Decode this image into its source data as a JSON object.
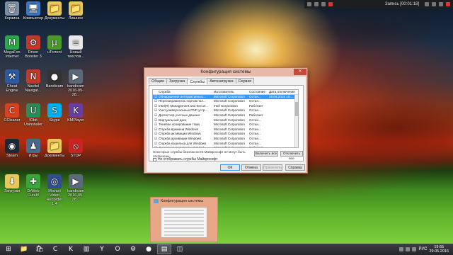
{
  "topbar": {
    "rec_label": "Запись [00:01:18]"
  },
  "desktop_icons": [
    {
      "label": "Корзина",
      "icon": "recycle-bin-icon",
      "color": "#7a8ea8",
      "glyph": "🗑"
    },
    {
      "label": "Компьютер",
      "icon": "computer-icon",
      "color": "#3b78c4",
      "glyph": "🖥"
    },
    {
      "label": "Документы",
      "icon": "documents-icon",
      "color": "#e9c85b",
      "glyph": "📁"
    },
    {
      "label": "Лишнее",
      "icon": "folder-icon",
      "color": "#e9c85b",
      "glyph": "📁"
    },
    {
      "label": "MegaFon Internet",
      "icon": "megafon-icon",
      "color": "#2aa84a",
      "glyph": "M"
    },
    {
      "label": "Driver Booster 3",
      "icon": "driver-booster-icon",
      "color": "#c0392b",
      "glyph": "⚙"
    },
    {
      "label": "uTorrent",
      "icon": "utorrent-icon",
      "color": "#4a9a2a",
      "glyph": "µ"
    },
    {
      "label": "Новый текстов...",
      "icon": "text-file-icon",
      "color": "#e8e8e8",
      "glyph": "≡"
    },
    {
      "label": "Cheat Engine",
      "icon": "cheat-engine-icon",
      "color": "#2c5aa0",
      "glyph": "⚒"
    },
    {
      "label": "Navitel Navigat...",
      "icon": "navitel-icon",
      "color": "#c0392b",
      "glyph": "N"
    },
    {
      "label": "Bandicam",
      "icon": "bandicam-icon",
      "color": "#333333",
      "glyph": "●"
    },
    {
      "label": "bandicam 2016-05-28...",
      "icon": "video-file-icon",
      "color": "#5b6a7a",
      "glyph": "▶"
    },
    {
      "label": "CCleaner",
      "icon": "ccleaner-icon",
      "color": "#d9411e",
      "glyph": "C"
    },
    {
      "label": "IObit Uninstaller",
      "icon": "iobit-uninstaller-icon",
      "color": "#2e8b57",
      "glyph": "U"
    },
    {
      "label": "Skype",
      "icon": "skype-icon",
      "color": "#00aff0",
      "glyph": "S"
    },
    {
      "label": "KMPlayer",
      "icon": "kmplayer-icon",
      "color": "#6a3ea1",
      "glyph": "K"
    },
    {
      "label": "Steam",
      "icon": "steam-icon",
      "color": "#1b2838",
      "glyph": "◉"
    },
    {
      "label": "Игры",
      "icon": "games-icon",
      "color": "#4a6a8a",
      "glyph": "♟"
    },
    {
      "label": "Документы",
      "icon": "documents-icon",
      "color": "#e9c85b",
      "glyph": "📁"
    },
    {
      "label": "STOP",
      "icon": "stop-icon",
      "color": "#cc2222",
      "glyph": "⦸"
    },
    {
      "label": "Загрузки",
      "icon": "downloads-icon",
      "color": "#e9c85b",
      "glyph": "⬇"
    },
    {
      "label": "DrWeb CureIt!",
      "icon": "drweb-icon",
      "color": "#3aa63a",
      "glyph": "✚"
    },
    {
      "label": "Movavi Video Recorder 1.4",
      "icon": "movavi-icon",
      "color": "#2f4f8f",
      "glyph": "◎"
    },
    {
      "label": "bandicam 2016-05-28...",
      "icon": "video-file-icon",
      "color": "#5b6a7a",
      "glyph": "▶"
    }
  ],
  "dialog": {
    "title": "Конфигурация системы",
    "close_glyph": "✕",
    "tabs": [
      "Общие",
      "Загрузка",
      "Службы",
      "Автозагрузка",
      "Сервис"
    ],
    "active_tab": 2,
    "columns": [
      "Служба",
      "Изготовитель",
      "Состояние",
      "Дата отключения"
    ],
    "rows": [
      {
        "name": "Обнаружение интерактивных...",
        "mfr": "Microsoft Corporation",
        "status": "Остан...",
        "date": "28.05.2016 19:...",
        "checked": true,
        "selected": true
      },
      {
        "name": "Перенаправитель портов пол...",
        "mfr": "Microsoft Corporation",
        "status": "Остан...",
        "date": "",
        "checked": true,
        "selected": false
      },
      {
        "name": "Intel(R) Management and Securi...",
        "mfr": "Intel Corporation",
        "status": "Работает",
        "date": "",
        "checked": true,
        "selected": false
      },
      {
        "name": "Узел универсальных PNP-устр...",
        "mfr": "Microsoft Corporation",
        "status": "Остан...",
        "date": "",
        "checked": true,
        "selected": false
      },
      {
        "name": "Диспетчер учетных данных",
        "mfr": "Microsoft Corporation",
        "status": "Работает",
        "date": "",
        "checked": true,
        "selected": false
      },
      {
        "name": "Виртуальный диск",
        "mfr": "Microsoft Corporation",
        "status": "Остан...",
        "date": "",
        "checked": true,
        "selected": false
      },
      {
        "name": "Теневое копирование тома",
        "mfr": "Microsoft Corporation",
        "status": "Остан...",
        "date": "",
        "checked": true,
        "selected": false
      },
      {
        "name": "Служба времени Windows",
        "mfr": "Microsoft Corporation",
        "status": "Остан...",
        "date": "",
        "checked": true,
        "selected": false
      },
      {
        "name": "Служба активации Windows",
        "mfr": "Microsoft Corporation",
        "status": "Остан...",
        "date": "",
        "checked": true,
        "selected": false
      },
      {
        "name": "Служба архивации Windows",
        "mfr": "Microsoft Corporation",
        "status": "Остан...",
        "date": "",
        "checked": true,
        "selected": false
      },
      {
        "name": "Служба кошелька для Windows",
        "mfr": "Microsoft Corporation",
        "status": "Остан...",
        "date": "",
        "checked": true,
        "selected": false
      },
      {
        "name": "Диспетчер подключений Wind...",
        "mfr": "Microsoft Corporation",
        "status": "Работает",
        "date": "",
        "checked": true,
        "selected": false
      }
    ],
    "note": "Некоторые службы безопасности Майкрософт не могут быть отключены.",
    "enable_all": "Включить все",
    "disable_all": "Отключить все",
    "hide_ms_label": "Не отображать службы Майкрософт",
    "hide_ms_checked": false,
    "buttons": {
      "ok": "ОК",
      "cancel": "Отмена",
      "apply": "Применить",
      "help": "Справка"
    },
    "accent": "#3399ff",
    "frame_color": "#e8b8a8"
  },
  "preview": {
    "title": "Конфигурация системы"
  },
  "taskbar": {
    "items": [
      {
        "icon": "windows-start-icon",
        "glyph": "⊞",
        "active": false
      },
      {
        "icon": "file-explorer-icon",
        "glyph": "📁",
        "active": false
      },
      {
        "icon": "store-icon",
        "glyph": "🛍",
        "active": false
      },
      {
        "icon": "ccleaner-taskbar-icon",
        "glyph": "C",
        "active": false
      },
      {
        "icon": "kmplayer-taskbar-icon",
        "glyph": "K",
        "active": false
      },
      {
        "icon": "charts-icon",
        "glyph": "▥",
        "active": false
      },
      {
        "icon": "yandex-browser-icon",
        "glyph": "Y",
        "active": false
      },
      {
        "icon": "opera-icon",
        "glyph": "O",
        "active": false
      },
      {
        "icon": "driver-booster-taskbar-icon",
        "glyph": "⚙",
        "active": false
      },
      {
        "icon": "bandicam-taskbar-icon",
        "glyph": "●",
        "active": false
      },
      {
        "icon": "msconfig-taskbar-icon",
        "glyph": "▤",
        "active": true
      },
      {
        "icon": "network-taskbar-icon",
        "glyph": "◫",
        "active": false
      }
    ],
    "lang": "РУС",
    "time": "19:55",
    "date": "29.05.2016"
  }
}
